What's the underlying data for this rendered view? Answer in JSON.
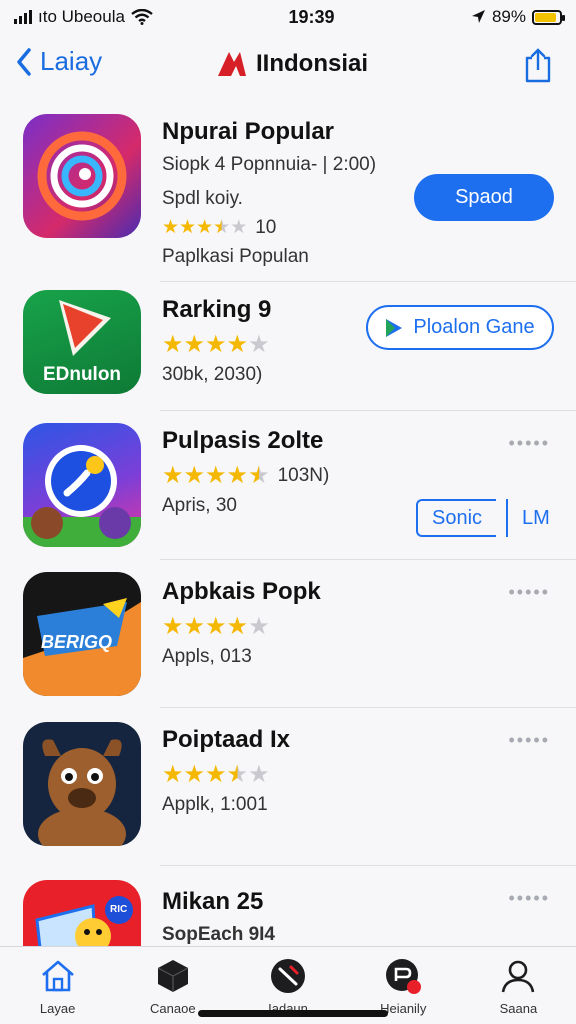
{
  "status_bar": {
    "carrier": "ıto Ubeoula",
    "time": "19:39",
    "battery": "89%",
    "battery_level": 0.89
  },
  "nav": {
    "back_label": "Laiay",
    "title": "IIndonsiai"
  },
  "apps": [
    {
      "name": "Npurai Popular",
      "line1": "Siopk 4 Popnnuia- | 2:00)",
      "line2": "Spdl koiy.",
      "rating": 3.5,
      "rating_count": "10",
      "line3": "Paplkasi Populan",
      "button": "Spaod",
      "icon": "spiral-app-icon"
    },
    {
      "name": "Rarking 9",
      "rating": 4,
      "line1": "30bk, 2030)",
      "button": "Ploalon Gane",
      "button_icon": "play-store-icon",
      "icon_text": "EDnulon",
      "icon": "play-triangle-app-icon"
    },
    {
      "name": "Pulpasis 2olte",
      "rating": 4.5,
      "rating_count": "103N)",
      "line1": "Apris, 30",
      "button": "Sonic",
      "side_label": "LM",
      "icon": "game-circle-app-icon"
    },
    {
      "name": "Apbkais Popk",
      "rating": 4,
      "line1": "Appls, 013",
      "icon_text": "BERIGQ",
      "icon": "banner-app-icon"
    },
    {
      "name": "Poiptaad Ix",
      "rating": 3.5,
      "line1": "Applk, 1:001",
      "icon": "bull-character-app-icon"
    },
    {
      "name": "Mikan 25",
      "line1": "SopEach 9I4",
      "icon_text": "RIC",
      "icon": "cartoon-app-icon"
    }
  ],
  "tabs": [
    {
      "label": "Layae",
      "icon": "home-icon"
    },
    {
      "label": "Canaoe",
      "icon": "cube-icon"
    },
    {
      "label": "Iadaun",
      "icon": "rocket-icon"
    },
    {
      "label": "Heianily",
      "icon": "chat-badge-icon"
    },
    {
      "label": "Saana",
      "icon": "person-icon"
    }
  ]
}
